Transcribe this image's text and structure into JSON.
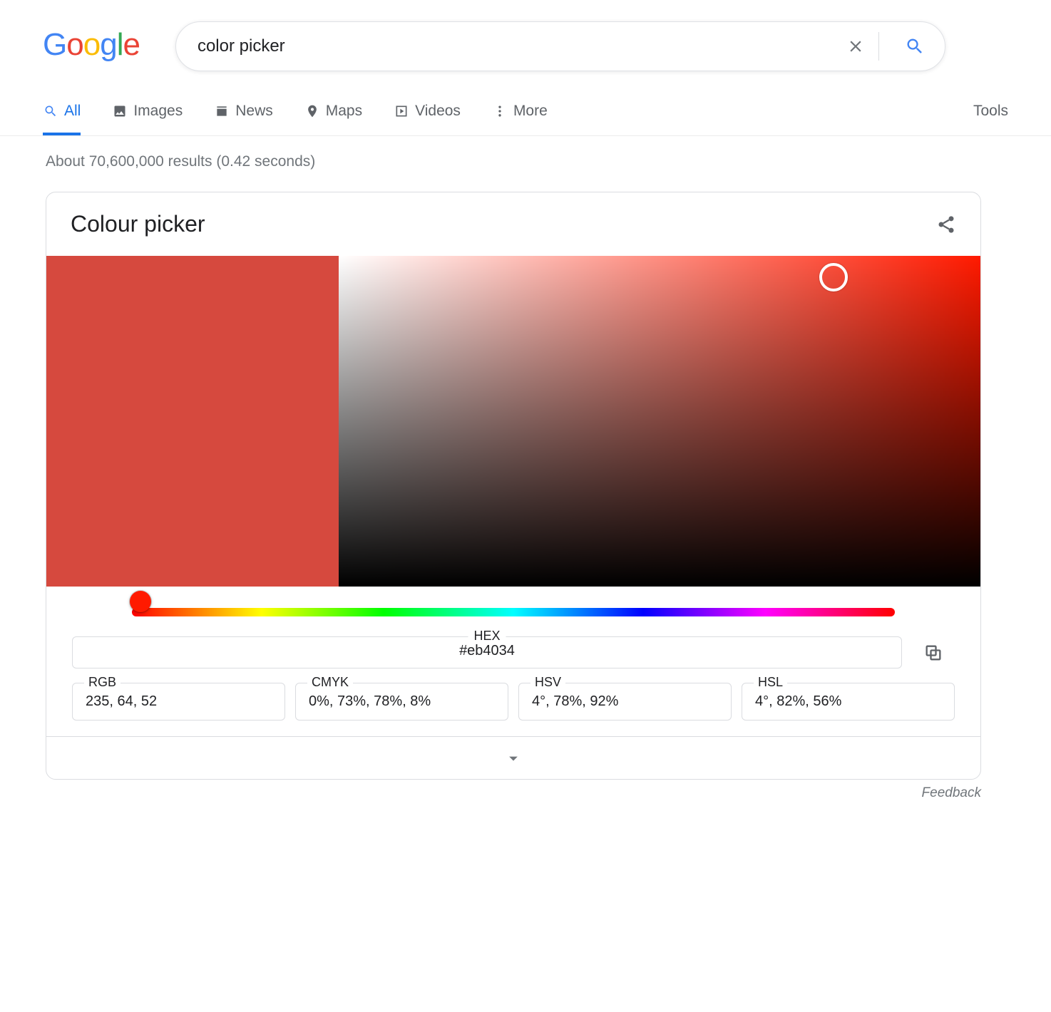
{
  "search": {
    "query": "color picker"
  },
  "tabs": {
    "all": "All",
    "images": "Images",
    "news": "News",
    "maps": "Maps",
    "videos": "Videos",
    "more": "More",
    "tools": "Tools"
  },
  "stats": "About 70,600,000 results (0.42 seconds)",
  "picker": {
    "title": "Colour picker",
    "hex_label": "HEX",
    "hex_value": "#eb4034",
    "fields": {
      "rgb": {
        "label": "RGB",
        "value": "235, 64, 52"
      },
      "cmyk": {
        "label": "CMYK",
        "value": "0%, 73%, 78%, 8%"
      },
      "hsv": {
        "label": "HSV",
        "value": "4°, 78%, 92%"
      },
      "hsl": {
        "label": "HSL",
        "value": "4°, 82%, 56%"
      }
    },
    "swatch_color": "#d6493e",
    "hue_color": "#ff1a00"
  },
  "feedback": "Feedback"
}
